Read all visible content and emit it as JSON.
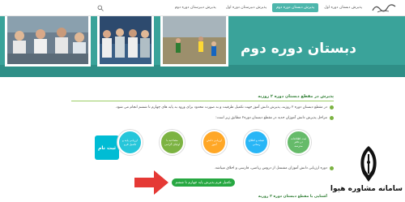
{
  "nav": {
    "items": [
      {
        "label": "پذیرش دبستان دوره اول"
      },
      {
        "label": "پذیرش دبستان دوره دوم",
        "active": true
      },
      {
        "label": "پذیرش دبیرستان دوره اول"
      },
      {
        "label": "پذیرش دبیرستان دوره دوم"
      }
    ]
  },
  "hero": {
    "title": "دبستان دوره دوم"
  },
  "content": {
    "section_title": "پذیرش در مقطع دبستان دوره ۲ روزبه",
    "para1": "در مقطع دبستان دوره ۲ روزبه، پذیرش دانش آموز جهت تکمیل ظرفیت و به صورت محدود برای ورود به پایه های چهارم تا ششم انجام می شود.",
    "para2": "مراحل پذیرش دانش آموزان جدید در مقطع دبستان دوره۲ مطابق زیر است:",
    "para3": "دوره ارزیابی دانش آموزان مشتمل از دروس ریاضی، فارسی و اخلاق میباشد.",
    "fav_label": "ثبت نام",
    "steps": [
      {
        "label": "ارزیابی پایه و تکمیل فرم",
        "color": "#26c6da"
      },
      {
        "label": "مصاحبه با اولیای گرامی",
        "color": "#7cb342"
      },
      {
        "label": "ارزیابی دانش آموز",
        "color": "#ffa726"
      },
      {
        "label": "نتیجه و اطلاع رسانی",
        "color": "#29b6f6"
      },
      {
        "label": "ثبت اطلاعات در دفتر مدرسه",
        "color": "#66bb6a"
      }
    ],
    "cta_label": "تکمیل فرم پذیرش پایه چهارم تا ششم",
    "footer_title": "آشنایی با مقطع دبستان دوره ۲ روزبه"
  },
  "badge": {
    "text": "سامانه مشاوره هیوا"
  },
  "colors": {
    "teal": "#3aa39a",
    "green": "#27a842",
    "red_arrow": "#e53935"
  }
}
